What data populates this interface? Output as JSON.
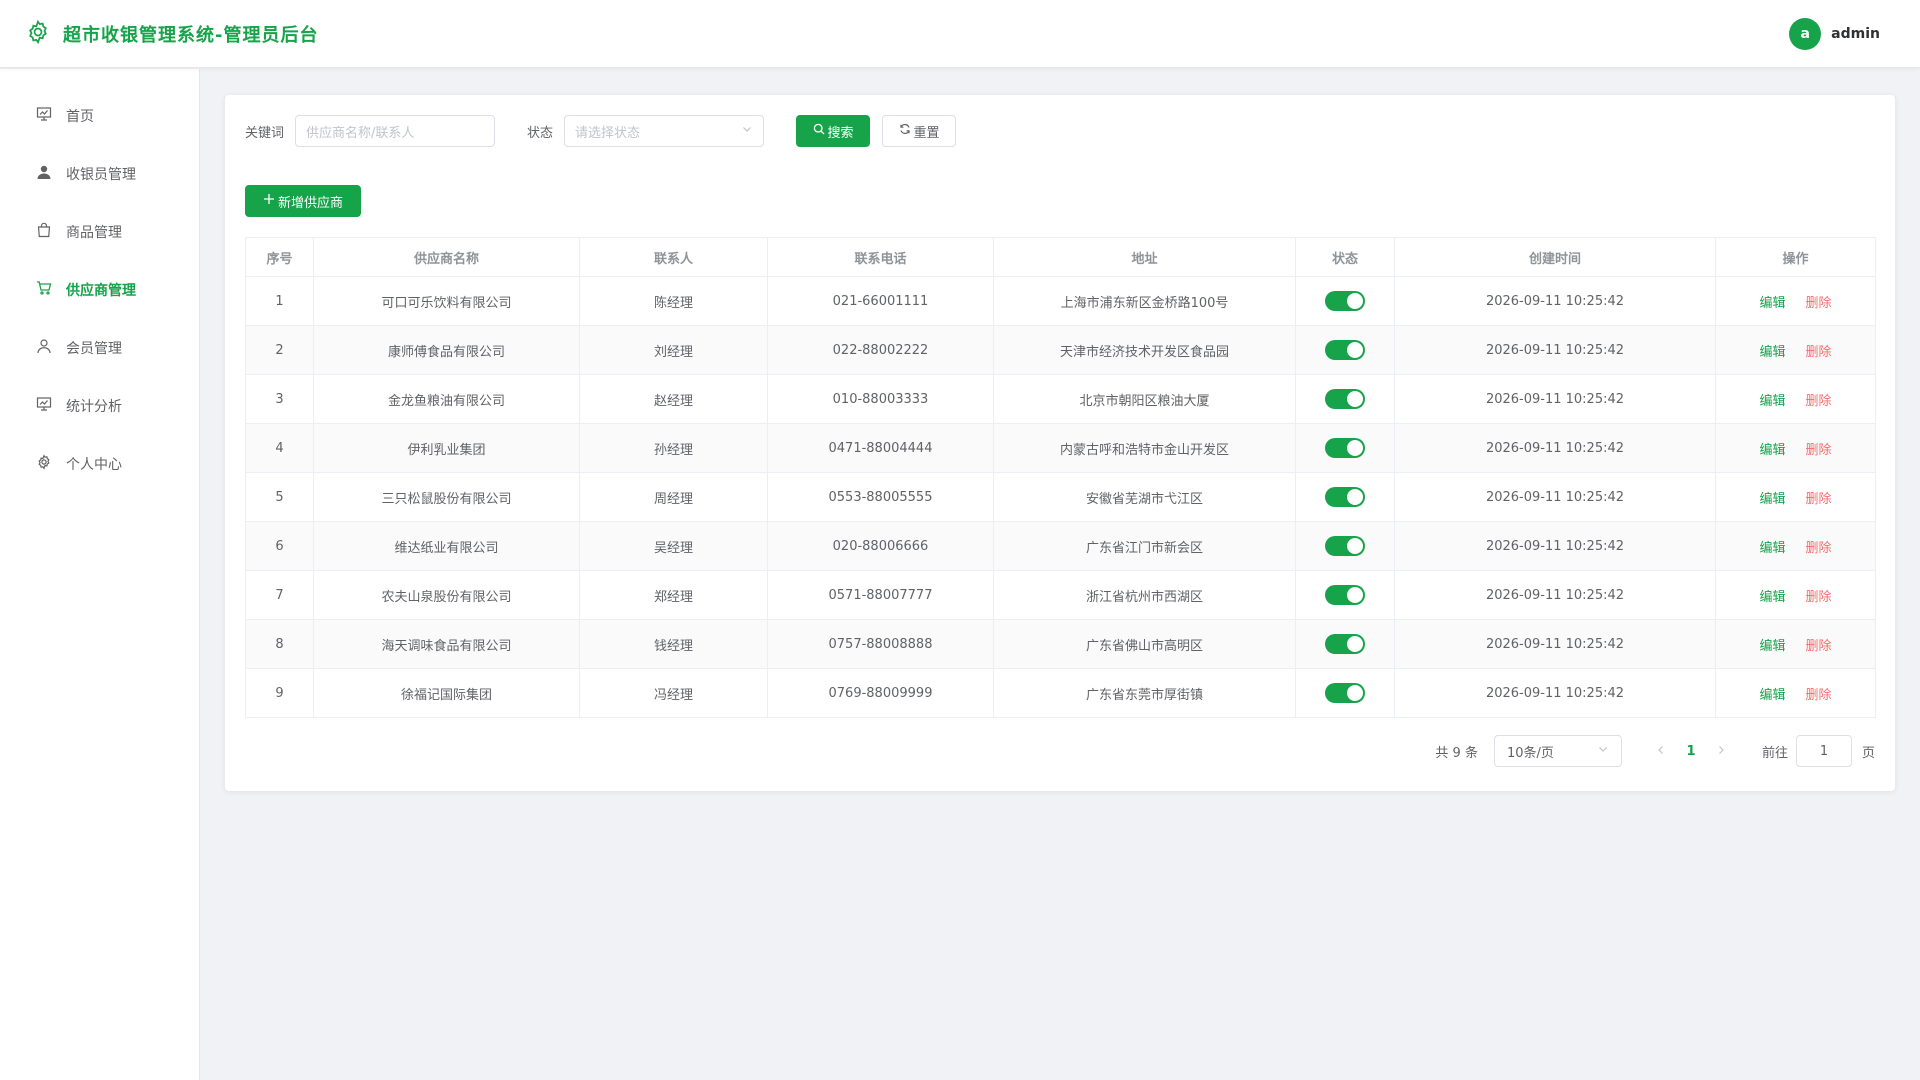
{
  "header": {
    "title": "超市收银管理系统-管理员后台",
    "avatar_letter": "a",
    "username": "admin"
  },
  "sidebar": {
    "items": [
      {
        "label": "首页",
        "icon": "dashboard-icon"
      },
      {
        "label": "收银员管理",
        "icon": "user-icon"
      },
      {
        "label": "商品管理",
        "icon": "bag-icon"
      },
      {
        "label": "供应商管理",
        "icon": "cart-icon",
        "active": true
      },
      {
        "label": "会员管理",
        "icon": "user-outline-icon"
      },
      {
        "label": "统计分析",
        "icon": "chart-board-icon"
      },
      {
        "label": "个人中心",
        "icon": "gear-icon"
      }
    ]
  },
  "filter": {
    "keyword_label": "关键词",
    "keyword_placeholder": "供应商名称/联系人",
    "status_label": "状态",
    "status_placeholder": "请选择状态",
    "search_label": "搜索",
    "reset_label": "重置",
    "add_label": "新增供应商"
  },
  "table": {
    "columns": [
      "序号",
      "供应商名称",
      "联系人",
      "联系电话",
      "地址",
      "状态",
      "创建时间",
      "操作"
    ],
    "edit_label": "编辑",
    "delete_label": "删除",
    "rows": [
      {
        "no": "1",
        "name": "可口可乐饮料有限公司",
        "contact": "陈经理",
        "phone": "021-66001111",
        "address": "上海市浦东新区金桥路100号",
        "enabled": true,
        "created": "2026-09-11 10:25:42"
      },
      {
        "no": "2",
        "name": "康师傅食品有限公司",
        "contact": "刘经理",
        "phone": "022-88002222",
        "address": "天津市经济技术开发区食品园",
        "enabled": true,
        "created": "2026-09-11 10:25:42"
      },
      {
        "no": "3",
        "name": "金龙鱼粮油有限公司",
        "contact": "赵经理",
        "phone": "010-88003333",
        "address": "北京市朝阳区粮油大厦",
        "enabled": true,
        "created": "2026-09-11 10:25:42"
      },
      {
        "no": "4",
        "name": "伊利乳业集团",
        "contact": "孙经理",
        "phone": "0471-88004444",
        "address": "内蒙古呼和浩特市金山开发区",
        "enabled": true,
        "created": "2026-09-11 10:25:42"
      },
      {
        "no": "5",
        "name": "三只松鼠股份有限公司",
        "contact": "周经理",
        "phone": "0553-88005555",
        "address": "安徽省芜湖市弋江区",
        "enabled": true,
        "created": "2026-09-11 10:25:42"
      },
      {
        "no": "6",
        "name": "维达纸业有限公司",
        "contact": "吴经理",
        "phone": "020-88006666",
        "address": "广东省江门市新会区",
        "enabled": true,
        "created": "2026-09-11 10:25:42"
      },
      {
        "no": "7",
        "name": "农夫山泉股份有限公司",
        "contact": "郑经理",
        "phone": "0571-88007777",
        "address": "浙江省杭州市西湖区",
        "enabled": true,
        "created": "2026-09-11 10:25:42"
      },
      {
        "no": "8",
        "name": "海天调味食品有限公司",
        "contact": "钱经理",
        "phone": "0757-88008888",
        "address": "广东省佛山市高明区",
        "enabled": true,
        "created": "2026-09-11 10:25:42"
      },
      {
        "no": "9",
        "name": "徐福记国际集团",
        "contact": "冯经理",
        "phone": "0769-88009999",
        "address": "广东省东莞市厚街镇",
        "enabled": true,
        "created": "2026-09-11 10:25:42"
      }
    ]
  },
  "pagination": {
    "total_text": "共 9 条",
    "page_size": "10条/页",
    "current_page": "1",
    "goto_label": "前往",
    "goto_value": "1",
    "page_suffix": "页"
  },
  "colors": {
    "primary": "#16a34a",
    "danger": "#f56c6c"
  }
}
